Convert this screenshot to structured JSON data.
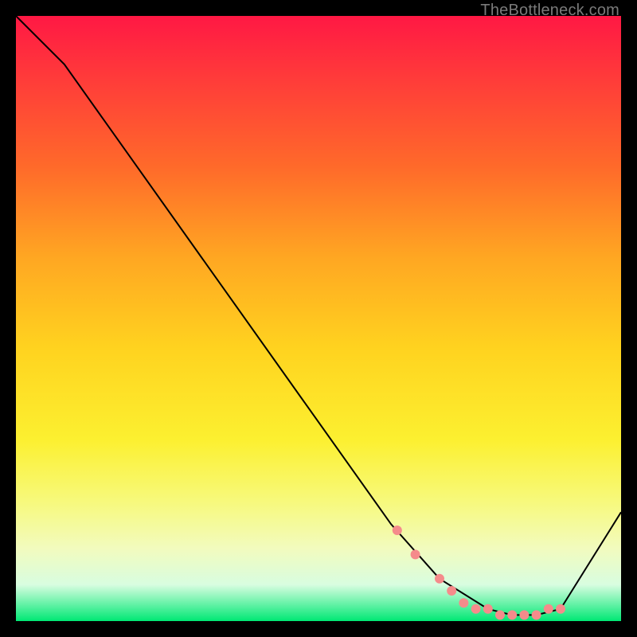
{
  "watermark": "TheBottleneck.com",
  "colors": {
    "background": "#000000",
    "line": "#000000",
    "dots": "#f58b8b",
    "gradient_top": "#ff1844",
    "gradient_bottom": "#00e874"
  },
  "chart_data": {
    "type": "line",
    "title": "",
    "xlabel": "",
    "ylabel": "",
    "xlim": [
      0,
      100
    ],
    "ylim": [
      0,
      100
    ],
    "x": [
      0,
      8,
      62,
      70,
      78,
      82,
      86,
      90,
      100
    ],
    "values": [
      100,
      92,
      16,
      7,
      2,
      1,
      1,
      2,
      18
    ],
    "markers": {
      "x": [
        63,
        66,
        70,
        72,
        74,
        76,
        78,
        80,
        82,
        84,
        86,
        88,
        90
      ],
      "values": [
        15,
        11,
        7,
        5,
        3,
        2,
        2,
        1,
        1,
        1,
        1,
        2,
        2
      ]
    }
  }
}
